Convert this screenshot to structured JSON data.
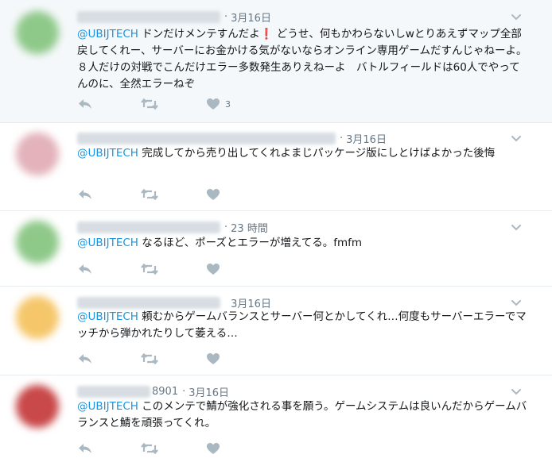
{
  "tweets": [
    {
      "name_tail": "",
      "date": "3月16日",
      "mention": "@UBIJTECH",
      "text_before": " ドンだけメンテすんだよ",
      "exclaim": "❗",
      "text_after": " どうせ、何もかわらないしwとりあえずマップ全部戻してくれー、サーバーにお金かける気がないならオンライン専用ゲームだすんじゃねーよ。８人だけの対戦でこんだけエラー多数発生ありえねーよ　バトルフィールドは60人でやってんのに、全然エラーねぞ",
      "like_count": "3"
    },
    {
      "name_tail": "",
      "date": "3月16日",
      "mention": "@UBIJTECH",
      "text": " 完成してから売り出してくれよまじパッケージ版にしとけばよかった後悔",
      "like_count": ""
    },
    {
      "name_tail": "",
      "date": "23 時間",
      "mention": "@UBIJTECH",
      "text": " なるほど、ポーズとエラーが増えてる。fmfm",
      "like_count": ""
    },
    {
      "name_tail": "",
      "date": "3月16日",
      "mention": "@UBIJTECH",
      "text": " 頼むからゲームバランスとサーバー何とかしてくれ…何度もサーバーエラーでマッチから弾かれたりして萎える…",
      "like_count": ""
    },
    {
      "name_tail": "8901",
      "date": "3月16日",
      "mention": "@UBIJTECH",
      "text": " このメンテで鯖が強化される事を願う。ゲームシステムは良いんだからゲームバランスと鯖を頑張ってくれ。",
      "like_count": ""
    }
  ],
  "separator": "·",
  "icons": {
    "reply": "reply-icon",
    "retweet": "retweet-icon",
    "like": "heart-icon",
    "more": "chevron-down-icon"
  },
  "colors": {
    "mention": "#1b95e0",
    "meta": "#657786",
    "icon": "#aab8c2",
    "highlight_bg": "#f5f8fa",
    "border": "#e6ecf0"
  }
}
